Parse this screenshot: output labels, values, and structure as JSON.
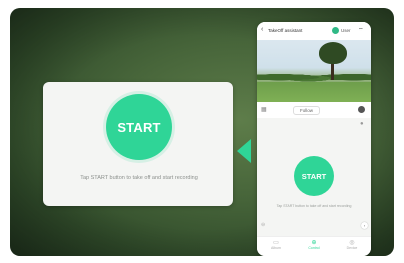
{
  "colors": {
    "accent": "#2fd597",
    "card_bg": "#47653a"
  },
  "left_panel": {
    "start_label": "START",
    "caption": "Tap START button to take off and start recording"
  },
  "phone": {
    "header": {
      "back_icon": "chevron-left-icon",
      "title": "TakeOff assistant",
      "user": "User",
      "status_icon": "wifi-icon"
    },
    "row": {
      "left_icon": "grid-icon",
      "selector": "Follow",
      "right_icon": "record-icon"
    },
    "start_label": "START",
    "caption": "Tap START button to take off and start recording",
    "tabs": [
      {
        "label": "Album",
        "icon": "album-icon"
      },
      {
        "label": "Control",
        "icon": "control-icon"
      },
      {
        "label": "Device",
        "icon": "device-icon"
      }
    ]
  }
}
